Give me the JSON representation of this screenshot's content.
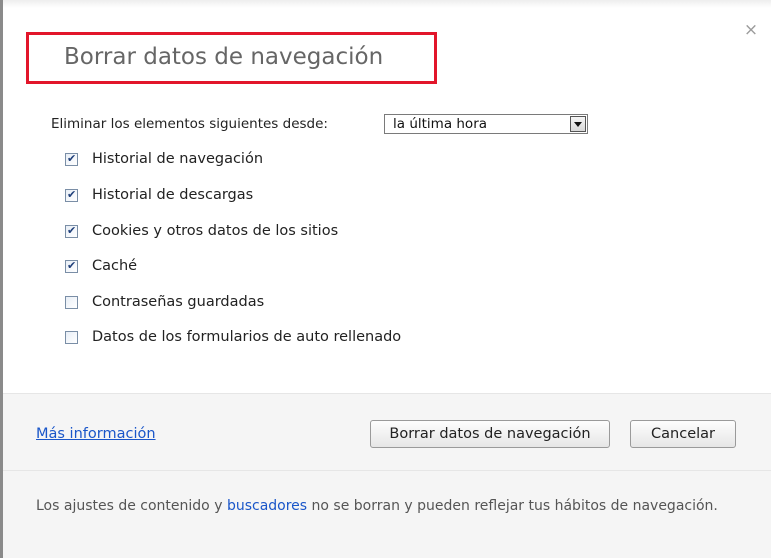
{
  "dialog": {
    "title": "Borrar datos de navegación",
    "close_symbol": "×"
  },
  "range": {
    "label": "Eliminar los elementos siguientes desde:",
    "selected": "la última hora"
  },
  "options": [
    {
      "label": "Historial de navegación",
      "checked": true
    },
    {
      "label": "Historial de descargas",
      "checked": true
    },
    {
      "label": "Cookies y otros datos de los sitios",
      "checked": true
    },
    {
      "label": "Caché",
      "checked": true
    },
    {
      "label": "Contraseñas guardadas",
      "checked": false
    },
    {
      "label": "Datos de los formularios de auto rellenado",
      "checked": false
    }
  ],
  "footer": {
    "more_info": "Más información",
    "clear_button": "Borrar datos de navegación",
    "cancel_button": "Cancelar"
  },
  "note": {
    "before": "Los ajustes de contenido y ",
    "link": "buscadores",
    "after": " no se borran y pueden reflejar tus hábitos de navegación."
  },
  "colors": {
    "highlight_border": "#e2162a",
    "link": "#1a56c9"
  }
}
